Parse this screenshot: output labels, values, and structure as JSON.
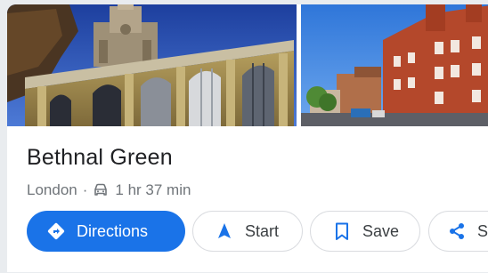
{
  "place": {
    "title": "Bethnal Green",
    "locality": "London",
    "separator": "·",
    "travel_time": "1 hr 37 min"
  },
  "actions": {
    "directions": "Directions",
    "start": "Start",
    "save": "Save",
    "share": "Sh"
  },
  "icons": {
    "directions": "directions-diamond-icon",
    "start": "navigation-arrow-icon",
    "save": "bookmark-icon",
    "share": "share-icon",
    "travel_mode": "car-icon"
  },
  "colors": {
    "primary": "#1a73e8",
    "title_text": "#202124",
    "secondary_text": "#70757a",
    "chip_border": "#dadce0"
  }
}
